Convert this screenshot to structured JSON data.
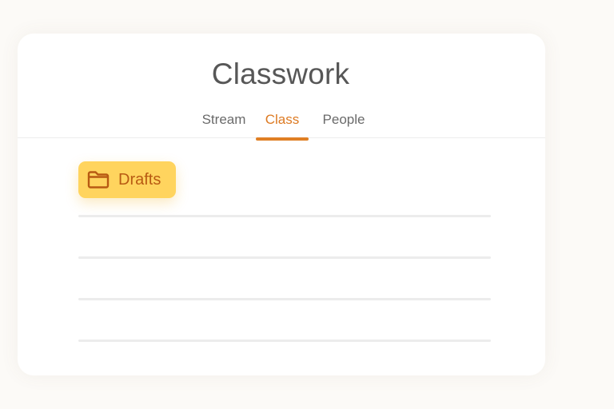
{
  "header": {
    "title": "Classwork"
  },
  "tabs": [
    {
      "label": "Stream",
      "active": false
    },
    {
      "label": "Class",
      "active": true
    },
    {
      "label": "People",
      "active": false
    }
  ],
  "drafts": {
    "label": "Drafts",
    "icon": "folder-icon"
  },
  "colors": {
    "accent": "#e07f24",
    "chip_background": "#ffd45e",
    "chip_text": "#b85a12"
  }
}
